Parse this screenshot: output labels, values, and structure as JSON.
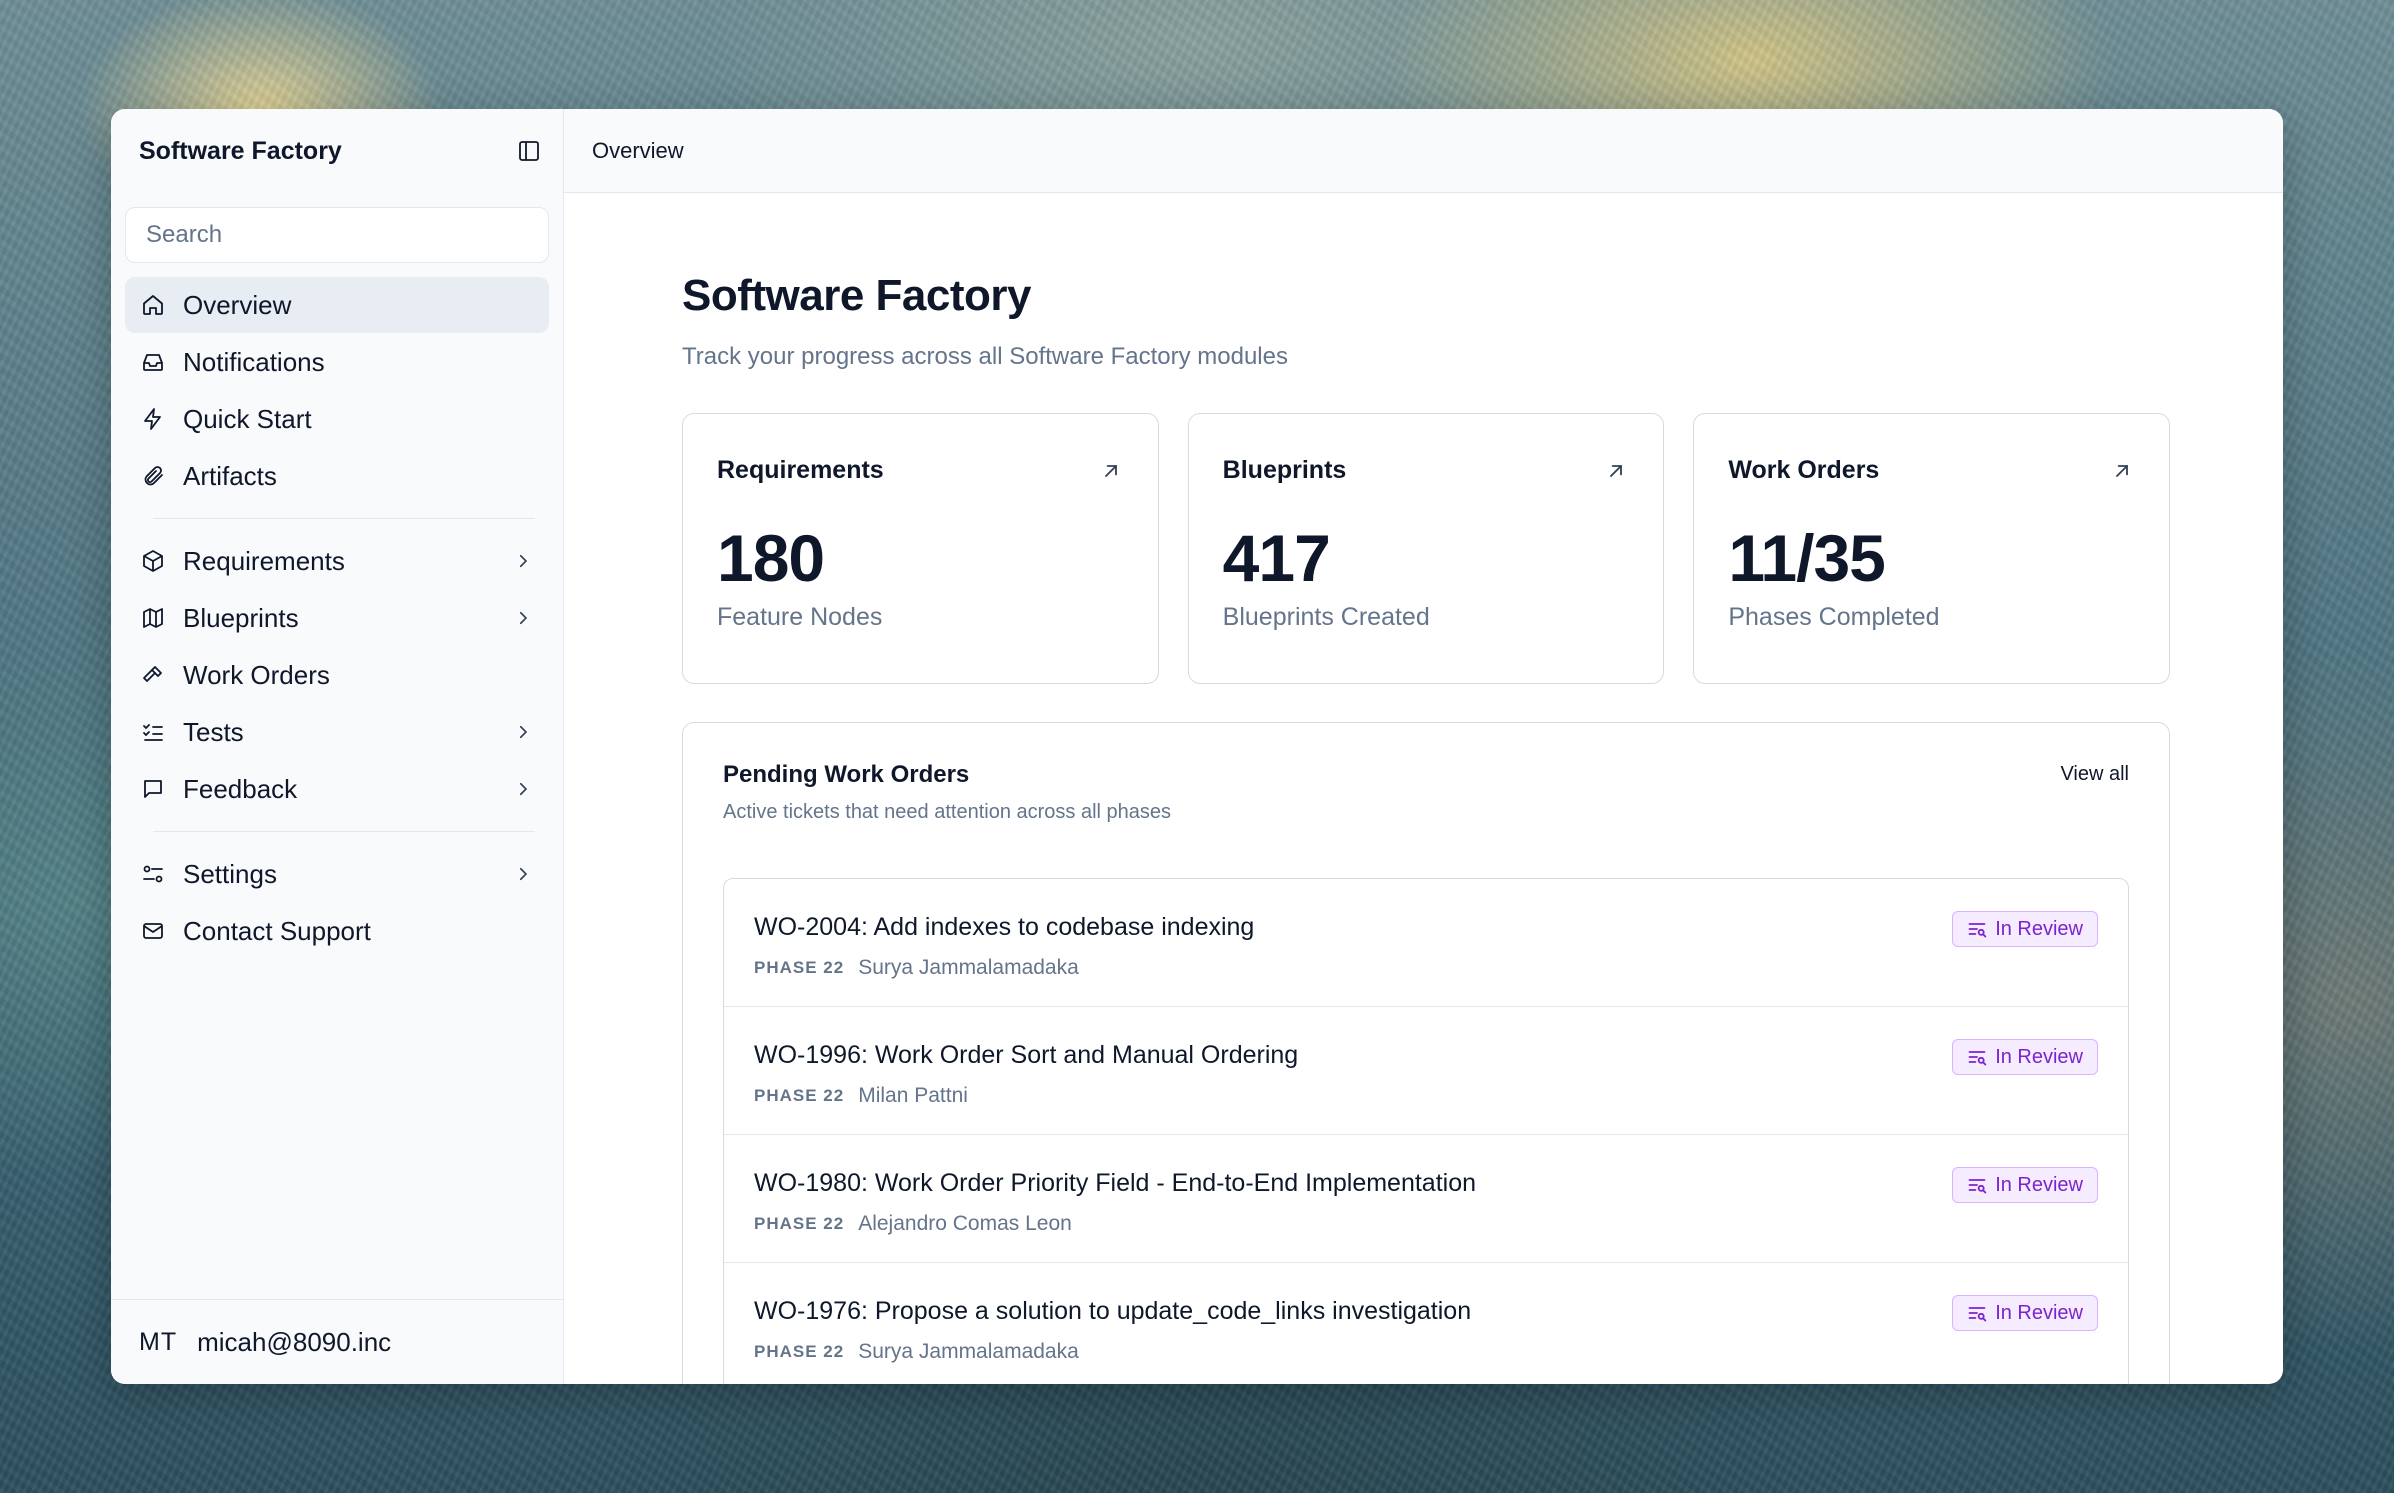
{
  "sidebar": {
    "app_title": "Software Factory",
    "search_placeholder": "Search",
    "items": [
      {
        "label": "Overview",
        "icon": "home-icon",
        "active": true
      },
      {
        "label": "Notifications",
        "icon": "inbox-icon"
      },
      {
        "label": "Quick Start",
        "icon": "lightning-icon"
      },
      {
        "label": "Artifacts",
        "icon": "paperclip-icon"
      },
      {
        "label": "Requirements",
        "icon": "box-icon",
        "chevron": true
      },
      {
        "label": "Blueprints",
        "icon": "map-icon",
        "chevron": true
      },
      {
        "label": "Work Orders",
        "icon": "hammer-icon"
      },
      {
        "label": "Tests",
        "icon": "checklist-icon",
        "chevron": true
      },
      {
        "label": "Feedback",
        "icon": "message-icon",
        "chevron": true
      },
      {
        "label": "Settings",
        "icon": "sliders-icon",
        "chevron": true
      },
      {
        "label": "Contact Support",
        "icon": "mail-icon"
      }
    ],
    "user": {
      "initials": "MT",
      "email": "micah@8090.inc"
    }
  },
  "topbar": {
    "breadcrumb": "Overview"
  },
  "page": {
    "title": "Software Factory",
    "subtitle": "Track your progress across all Software Factory modules"
  },
  "stats": [
    {
      "title": "Requirements",
      "value": "180",
      "caption": "Feature Nodes"
    },
    {
      "title": "Blueprints",
      "value": "417",
      "caption": "Blueprints Created"
    },
    {
      "title": "Work Orders",
      "value": "11/35",
      "caption": "Phases Completed"
    }
  ],
  "pending": {
    "title": "Pending Work Orders",
    "subtitle": "Active tickets that need attention across all phases",
    "view_all": "View all",
    "rows": [
      {
        "title": "WO-2004: Add indexes to codebase indexing",
        "phase": "PHASE 22",
        "assignee": "Surya Jammalamadaka",
        "status": "In Review"
      },
      {
        "title": "WO-1996: Work Order Sort and Manual Ordering",
        "phase": "PHASE 22",
        "assignee": "Milan Pattni",
        "status": "In Review"
      },
      {
        "title": "WO-1980: Work Order Priority Field - End-to-End Implementation",
        "phase": "PHASE 22",
        "assignee": "Alejandro Comas Leon",
        "status": "In Review"
      },
      {
        "title": "WO-1976: Propose a solution to update_code_links investigation",
        "phase": "PHASE 22",
        "assignee": "Surya Jammalamadaka",
        "status": "In Review"
      }
    ]
  },
  "colors": {
    "accent_purple": "#7e22ce",
    "badge_bg": "#f5ecff",
    "muted_text": "#64748b",
    "active_nav_bg": "#e8ecf3"
  }
}
